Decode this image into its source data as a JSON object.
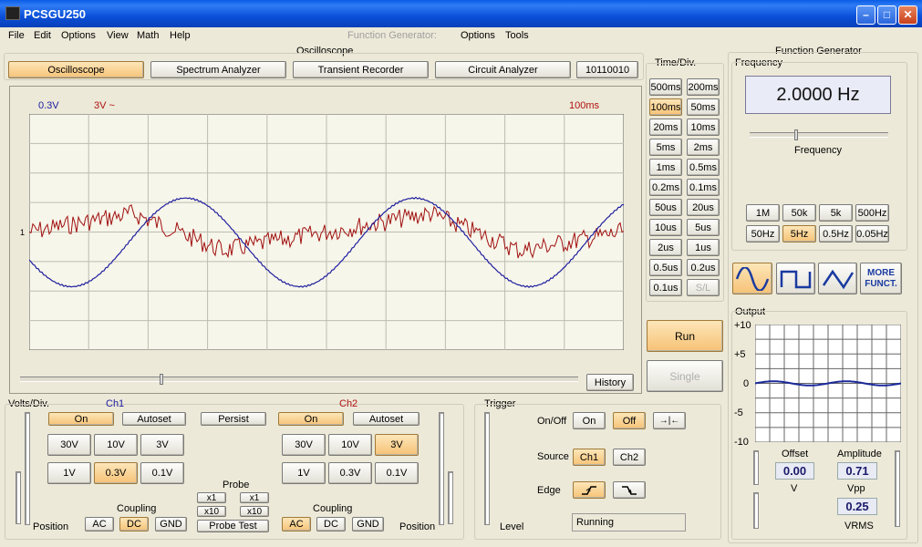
{
  "window": {
    "title": "PCSGU250"
  },
  "menu": {
    "file": "File",
    "edit": "Edit",
    "options": "Options",
    "view": "View",
    "math": "Math",
    "help": "Help",
    "fg_label": "Function Generator:",
    "fg_options": "Options",
    "fg_tools": "Tools"
  },
  "osc": {
    "group_title": "Oscilloscope",
    "tabs": [
      "Oscilloscope",
      "Spectrum Analyzer",
      "Transient Recorder",
      "Circuit Analyzer",
      "10110010"
    ],
    "ch1_scale": "0.3V",
    "ch2_scale": "3V ~",
    "time_label": "100ms",
    "marker": "1",
    "history": "History",
    "grid_divs_x": 10,
    "grid_divs_y": 8,
    "ch1_wave": {
      "color": "#2020a0",
      "freq_cycles": 2.6,
      "amplitude_div": 1.5,
      "offset_div": 0.35,
      "phase": 3.55
    },
    "ch2_wave": {
      "color": "#a01010",
      "cycles": 2,
      "amplitude_div": 0.7,
      "offset_div": 0,
      "noise": 0.3
    }
  },
  "timediv": {
    "title": "Time/Div.",
    "buttons": [
      "500ms",
      "200ms",
      "100ms",
      "50ms",
      "20ms",
      "10ms",
      "5ms",
      "2ms",
      "1ms",
      "0.5ms",
      "0.2ms",
      "0.1ms",
      "50us",
      "20us",
      "10us",
      "5us",
      "2us",
      "1us",
      "0.5us",
      "0.2us",
      "0.1us",
      "S/L"
    ],
    "selected": "100ms"
  },
  "run": {
    "run": "Run",
    "single": "Single"
  },
  "voltsdiv": {
    "title": "Volts/Div.",
    "ch1": "Ch1",
    "ch2": "Ch2",
    "on": "On",
    "autoset": "Autoset",
    "persist": "Persist",
    "ch1_buttons": [
      "30V",
      "10V",
      "3V",
      "1V",
      "0.3V",
      "0.1V"
    ],
    "ch1_selected": "0.3V",
    "ch2_buttons": [
      "30V",
      "10V",
      "3V",
      "1V",
      "0.3V",
      "0.1V"
    ],
    "ch2_selected": "3V",
    "probe": "Probe",
    "x1": "x1",
    "x10": "x10",
    "probe_test": "Probe Test",
    "coupling": "Coupling",
    "ac": "AC",
    "dc": "DC",
    "gnd": "GND",
    "position": "Position",
    "ch1_coupling": "DC",
    "ch2_coupling": "AC"
  },
  "trigger": {
    "title": "Trigger",
    "onoff": "On/Off",
    "on": "On",
    "off": "Off",
    "source": "Source",
    "ch1": "Ch1",
    "ch2": "Ch2",
    "edge": "Edge",
    "level": "Level",
    "status": "Running"
  },
  "fg": {
    "title": "Function Generator",
    "freq_title": "Frequency",
    "freq_value": "2.0000 Hz",
    "freq_slider_label": "Frequency",
    "range_buttons": [
      "1M",
      "50k",
      "5k",
      "500Hz",
      "50Hz",
      "5Hz",
      "0.5Hz",
      "0.05Hz"
    ],
    "range_selected": "5Hz",
    "more": "MORE FUNCT.",
    "output_title": "Output",
    "y_ticks": [
      "+10",
      "+5",
      "0",
      "-5",
      "-10"
    ],
    "output_wave": {
      "amplitude": 0.71,
      "offset": 0,
      "cycles": 2
    },
    "offset_label": "Offset",
    "offset_value": "0.00",
    "offset_unit": "V",
    "amplitude_label": "Amplitude",
    "amplitude_value": "0.71",
    "amplitude_unit": "Vpp",
    "vrms_value": "0.25",
    "vrms_unit": "VRMS"
  },
  "colors": {
    "selected": "#f6c276",
    "display_bg": "#f7f6ea",
    "grid": "#b8b8b0"
  }
}
